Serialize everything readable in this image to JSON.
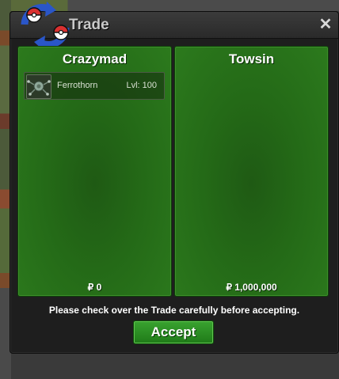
{
  "window": {
    "title": "Trade",
    "close_label": "✕"
  },
  "left_panel": {
    "player_name": "Crazymad",
    "money": "₽ 0",
    "items": [
      {
        "name": "Ferrothorn",
        "level": "Lvl: 100",
        "icon": "ferrothorn-icon"
      }
    ]
  },
  "right_panel": {
    "player_name": "Towsin",
    "money": "₽ 1,000,000",
    "items": []
  },
  "footer": {
    "notice": "Please check over the Trade carefully before accepting.",
    "accept_label": "Accept"
  },
  "colors": {
    "panel_green": "#246a17",
    "accept_green": "#2c8f24",
    "window_dark": "#1e1e1e",
    "pokeball_red": "#d93030",
    "arrow_blue": "#2a56c8"
  }
}
